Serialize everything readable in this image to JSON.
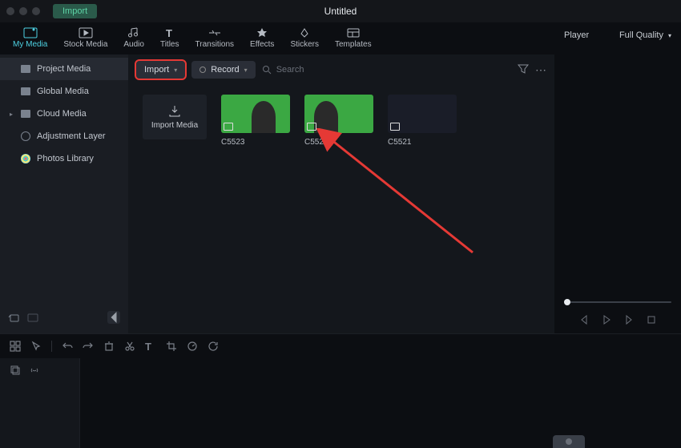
{
  "titlebar": {
    "importLabel": "Import",
    "docTitle": "Untitled"
  },
  "tabs": [
    {
      "label": "My Media",
      "active": true
    },
    {
      "label": "Stock Media"
    },
    {
      "label": "Audio"
    },
    {
      "label": "Titles"
    },
    {
      "label": "Transitions"
    },
    {
      "label": "Effects"
    },
    {
      "label": "Stickers"
    },
    {
      "label": "Templates"
    }
  ],
  "sidebar": [
    {
      "label": "Project Media",
      "active": true,
      "icon": "folder"
    },
    {
      "label": "Global Media",
      "icon": "folder"
    },
    {
      "label": "Cloud Media",
      "icon": "folder",
      "chev": true
    },
    {
      "label": "Adjustment Layer",
      "icon": "gear"
    },
    {
      "label": "Photos Library",
      "icon": "photo"
    }
  ],
  "toolbar": {
    "importLabel": "Import",
    "recordLabel": "Record",
    "searchPlaceholder": "Search"
  },
  "mediaGrid": {
    "importCardLabel": "Import Media",
    "items": [
      {
        "name": "C5523",
        "thumb": "green-person-right"
      },
      {
        "name": "C5522",
        "thumb": "green-person-left"
      },
      {
        "name": "C5521",
        "thumb": "dark"
      }
    ]
  },
  "player": {
    "title": "Player",
    "quality": "Full Quality"
  }
}
